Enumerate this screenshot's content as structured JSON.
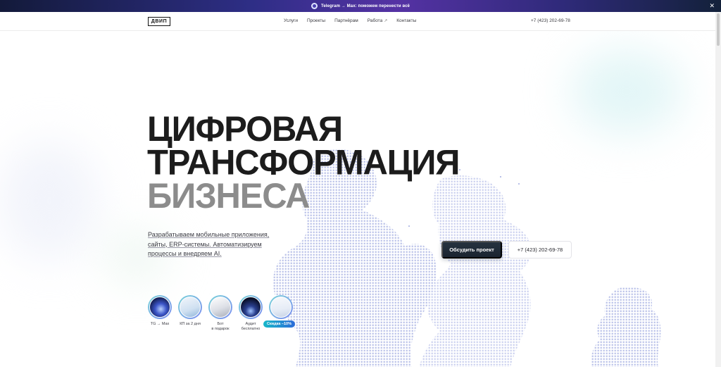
{
  "promo": {
    "icon": "telegram-icon",
    "text": "Telegram → Max: поможем перенести всё",
    "close_icon": "close-icon"
  },
  "header": {
    "logo_text": "ДВИП",
    "nav": [
      {
        "label": "Услуги"
      },
      {
        "label": "Проекты"
      },
      {
        "label": "Партнёрам"
      },
      {
        "label": "Работа",
        "icon": "external-link-icon"
      },
      {
        "label": "Контакты"
      }
    ],
    "phone": "+7 (423) 202-69-78"
  },
  "hero": {
    "title_line1": "ЦИФРОВАЯ",
    "title_line2": "ТРАНСФОРМАЦИЯ",
    "title_line3": "БИЗНЕСА",
    "subtitle_part1": "Разрабатываем мобильные приложения,",
    "subtitle_part2": "сайты, ERP-системы. Автоматизируем",
    "subtitle_part3": "процессы и внедряем AI.",
    "cta_label": "Обсудить проект",
    "phone_button": "+7 (423) 202-69-78"
  },
  "stories": [
    {
      "label": "TG → Max"
    },
    {
      "label": "КП за 2 дня"
    },
    {
      "label_line1": "Бот",
      "label_line2": "в подарок"
    },
    {
      "label_line1": "Аудит",
      "label_line2": "бесплатно"
    },
    {
      "badge": "Скидка –10%"
    }
  ],
  "colors": {
    "accent_dark": "#1f2a36",
    "badge": "#16b8c9",
    "dots": "#b5bde6"
  }
}
